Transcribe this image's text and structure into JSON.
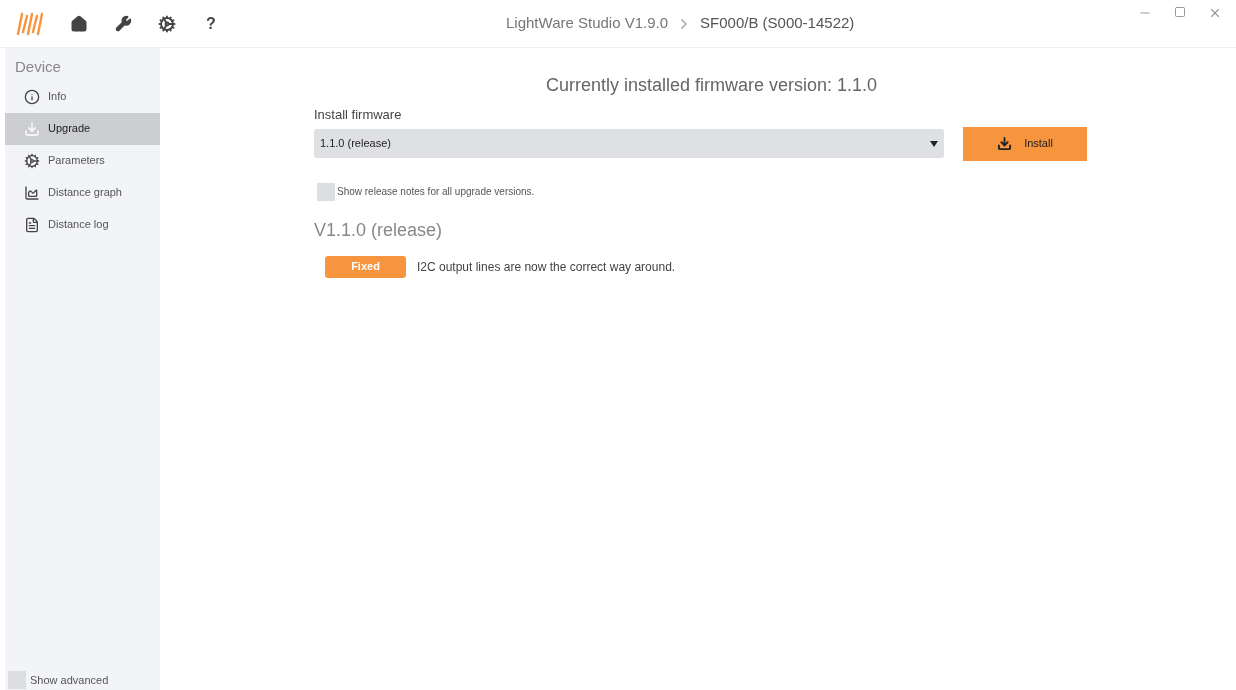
{
  "toolbar": {
    "help_label": "?"
  },
  "title_bar": {
    "app": "LightWare Studio V1.9.0",
    "device": "SF000/B (S000-14522)"
  },
  "sidebar": {
    "heading": "Device",
    "items": [
      {
        "label": "Info",
        "selected": false
      },
      {
        "label": "Upgrade",
        "selected": true
      },
      {
        "label": "Parameters",
        "selected": false
      },
      {
        "label": "Distance graph",
        "selected": false
      },
      {
        "label": "Distance log",
        "selected": false
      }
    ],
    "show_advanced": {
      "label": "Show advanced",
      "checked": false
    }
  },
  "main": {
    "installed": "Currently installed firmware version: 1.1.0",
    "install_label": "Install firmware",
    "firmware_select": {
      "value": "1.1.0 (release)"
    },
    "install_button": "Install",
    "release_notes_toggle": {
      "label": "Show release notes for all upgrade versions.",
      "checked": false
    },
    "release": {
      "title": "V1.1.0 (release)",
      "notes": [
        {
          "tag": "Fixed",
          "text": "I2C output lines are now the correct way around."
        }
      ]
    }
  }
}
